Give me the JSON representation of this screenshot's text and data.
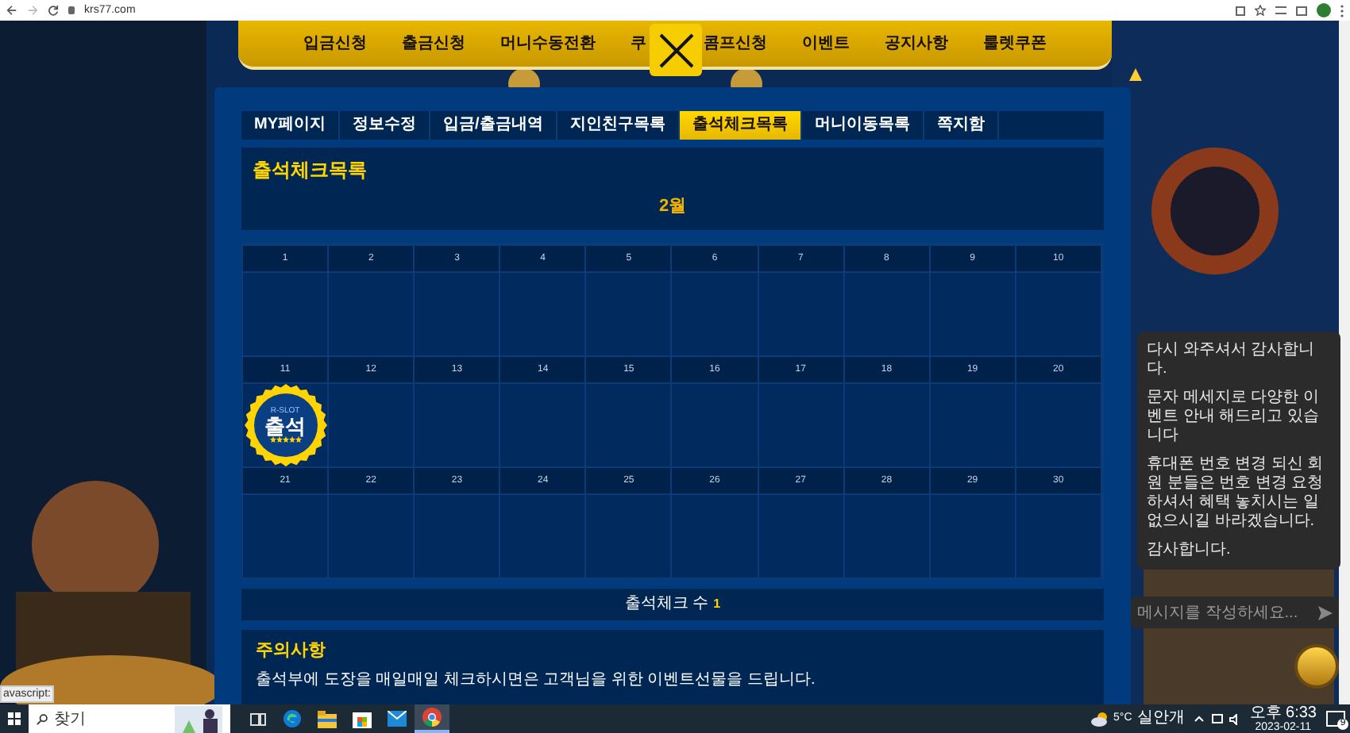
{
  "browser": {
    "url": "krs77.com"
  },
  "nav": {
    "items": [
      "입금신청",
      "출금신청",
      "머니수동전환",
      "쿠",
      "콤프신청",
      "이벤트",
      "공지사항",
      "룰렛쿠폰"
    ]
  },
  "tabs": [
    {
      "label": "MY페이지",
      "selected": false
    },
    {
      "label": "정보수정",
      "selected": false
    },
    {
      "label": "입금/출금내역",
      "selected": false
    },
    {
      "label": "지인친구목록",
      "selected": false
    },
    {
      "label": "출석체크목록",
      "selected": true
    },
    {
      "label": "머니이동목록",
      "selected": false
    },
    {
      "label": "쪽지함",
      "selected": false
    }
  ],
  "title": "출석체크목록",
  "month": "2월",
  "calendar": {
    "weeks": [
      [
        {
          "day": "1",
          "stamped": false
        },
        {
          "day": "2",
          "stamped": false
        },
        {
          "day": "3",
          "stamped": false
        },
        {
          "day": "4",
          "stamped": false
        },
        {
          "day": "5",
          "stamped": false
        },
        {
          "day": "6",
          "stamped": false
        },
        {
          "day": "7",
          "stamped": false
        },
        {
          "day": "8",
          "stamped": false
        },
        {
          "day": "9",
          "stamped": false
        },
        {
          "day": "10",
          "stamped": false
        }
      ],
      [
        {
          "day": "11",
          "stamped": true
        },
        {
          "day": "12",
          "stamped": false
        },
        {
          "day": "13",
          "stamped": false
        },
        {
          "day": "14",
          "stamped": false
        },
        {
          "day": "15",
          "stamped": false
        },
        {
          "day": "16",
          "stamped": false
        },
        {
          "day": "17",
          "stamped": false
        },
        {
          "day": "18",
          "stamped": false
        },
        {
          "day": "19",
          "stamped": false
        },
        {
          "day": "20",
          "stamped": false
        }
      ],
      [
        {
          "day": "21",
          "stamped": false
        },
        {
          "day": "22",
          "stamped": false
        },
        {
          "day": "23",
          "stamped": false
        },
        {
          "day": "24",
          "stamped": false
        },
        {
          "day": "25",
          "stamped": false
        },
        {
          "day": "26",
          "stamped": false
        },
        {
          "day": "27",
          "stamped": false
        },
        {
          "day": "28",
          "stamped": false
        },
        {
          "day": "29",
          "stamped": false
        },
        {
          "day": "30",
          "stamped": false
        }
      ]
    ]
  },
  "stamp": {
    "brand": "R-SLOT",
    "label": "출석",
    "stars": 5
  },
  "count": {
    "label": "출석체크 수",
    "value": "1"
  },
  "notice": {
    "title": "주의사항",
    "text": "출석부에 도장을 매일매일 체크하시면은 고객님을 위한 이벤트선물을 드립니다."
  },
  "status_tooltip": "avascript:",
  "chat": {
    "messages": [
      "다시 와주셔서 감사합니다.",
      "문자 메세지로 다양한 이벤트 안내 해드리고 있습니다",
      "휴대폰 번호 변경 되신 회원 분들은 번호 변경 요청 하셔서 혜택 놓치시는 일 없으시길 바라겠습니다.",
      "감사합니다."
    ],
    "placeholder": "메시지를 작성하세요..."
  },
  "taskbar": {
    "search_placeholder": "찾기",
    "apps": [
      {
        "kind": "taskview",
        "active": false
      },
      {
        "kind": "edge",
        "active": false
      },
      {
        "kind": "explorer",
        "active": false
      },
      {
        "kind": "store",
        "active": false
      },
      {
        "kind": "mail",
        "active": false
      },
      {
        "kind": "chrome",
        "active": true
      }
    ]
  },
  "weather": {
    "temp": "5°C",
    "condition": "실안개"
  },
  "clock": {
    "time": "오후 6:33",
    "date": "2023-02-11"
  },
  "notifications": "9"
}
